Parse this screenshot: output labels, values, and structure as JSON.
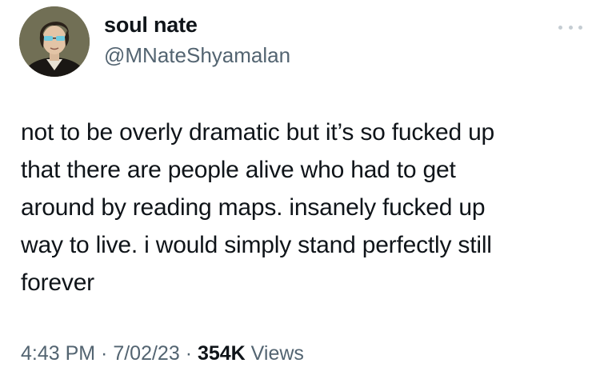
{
  "author": {
    "display_name": "soul nate",
    "handle": "@MNateShyamalan"
  },
  "tweet": {
    "text": "not to be overly dramatic but it’s so fucked up\nthat there are people alive who had to get\naround by reading maps. insanely fucked up\nway to live. i would simply stand perfectly still\nforever"
  },
  "meta": {
    "time": "4:43 PM",
    "sep1": " · ",
    "date": "7/02/23",
    "sep2": " · ",
    "views_count": "354K",
    "views_label": " Views"
  },
  "icons": {
    "more": "more-horizontal-icon",
    "avatar": "portrait-avatar"
  },
  "colors": {
    "text": "#0f1419",
    "secondary": "#536471",
    "more_dots": "#c5cdd3"
  }
}
